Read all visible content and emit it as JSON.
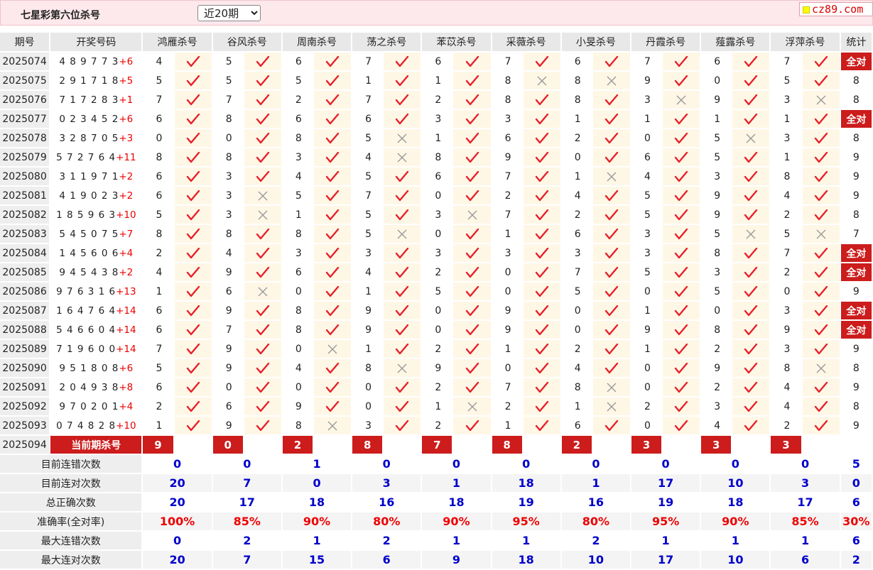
{
  "header": {
    "title": "七星彩第六位杀号",
    "period_select": "近20期",
    "logo_text": "cz89.com"
  },
  "columns": {
    "issue": "期号",
    "draw": "开奖号码",
    "experts": [
      "鸿雁杀号",
      "谷风杀号",
      "周南杀号",
      "荡之杀号",
      "苯苡杀号",
      "采薇杀号",
      "小旻杀号",
      "丹霞杀号",
      "薤露杀号",
      "浮萍杀号"
    ],
    "stat": "统计"
  },
  "rows": [
    {
      "issue": "2025074",
      "digits": "489773",
      "sum": "+6",
      "kills": [
        4,
        5,
        6,
        7,
        6,
        7,
        6,
        7,
        6,
        7
      ],
      "hits": [
        1,
        1,
        1,
        1,
        1,
        1,
        1,
        1,
        1,
        1
      ],
      "stat": "全对"
    },
    {
      "issue": "2025075",
      "digits": "291718",
      "sum": "+5",
      "kills": [
        5,
        5,
        5,
        1,
        1,
        8,
        8,
        9,
        0,
        5
      ],
      "hits": [
        1,
        1,
        1,
        1,
        1,
        0,
        0,
        1,
        1,
        1
      ],
      "stat": "8"
    },
    {
      "issue": "2025076",
      "digits": "717283",
      "sum": "+1",
      "kills": [
        7,
        7,
        2,
        7,
        2,
        8,
        8,
        3,
        9,
        3
      ],
      "hits": [
        1,
        1,
        1,
        1,
        1,
        1,
        1,
        0,
        1,
        0
      ],
      "stat": "8"
    },
    {
      "issue": "2025077",
      "digits": "023452",
      "sum": "+6",
      "kills": [
        6,
        8,
        6,
        6,
        3,
        3,
        1,
        1,
        1,
        1
      ],
      "hits": [
        1,
        1,
        1,
        1,
        1,
        1,
        1,
        1,
        1,
        1
      ],
      "stat": "全对"
    },
    {
      "issue": "2025078",
      "digits": "328705",
      "sum": "+3",
      "kills": [
        0,
        0,
        8,
        5,
        1,
        6,
        2,
        0,
        5,
        3
      ],
      "hits": [
        1,
        1,
        1,
        0,
        1,
        1,
        1,
        1,
        0,
        1
      ],
      "stat": "8"
    },
    {
      "issue": "2025079",
      "digits": "572764",
      "sum": "+11",
      "kills": [
        8,
        8,
        3,
        4,
        8,
        9,
        0,
        6,
        5,
        1
      ],
      "hits": [
        1,
        1,
        1,
        0,
        1,
        1,
        1,
        1,
        1,
        1
      ],
      "stat": "9"
    },
    {
      "issue": "2025080",
      "digits": "311971",
      "sum": "+2",
      "kills": [
        6,
        3,
        4,
        5,
        6,
        7,
        1,
        4,
        3,
        8
      ],
      "hits": [
        1,
        1,
        1,
        1,
        1,
        1,
        0,
        1,
        1,
        1
      ],
      "stat": "9"
    },
    {
      "issue": "2025081",
      "digits": "419023",
      "sum": "+2",
      "kills": [
        6,
        3,
        5,
        7,
        0,
        2,
        4,
        5,
        9,
        4
      ],
      "hits": [
        1,
        0,
        1,
        1,
        1,
        1,
        1,
        1,
        1,
        1
      ],
      "stat": "9"
    },
    {
      "issue": "2025082",
      "digits": "185963",
      "sum": "+10",
      "kills": [
        5,
        3,
        1,
        5,
        3,
        7,
        2,
        5,
        9,
        2
      ],
      "hits": [
        1,
        0,
        1,
        1,
        0,
        1,
        1,
        1,
        1,
        1
      ],
      "stat": "8"
    },
    {
      "issue": "2025083",
      "digits": "545075",
      "sum": "+7",
      "kills": [
        8,
        8,
        8,
        5,
        0,
        1,
        6,
        3,
        5,
        5
      ],
      "hits": [
        1,
        1,
        1,
        0,
        1,
        1,
        1,
        1,
        0,
        0
      ],
      "stat": "7"
    },
    {
      "issue": "2025084",
      "digits": "145606",
      "sum": "+4",
      "kills": [
        2,
        4,
        3,
        3,
        3,
        3,
        3,
        3,
        8,
        7
      ],
      "hits": [
        1,
        1,
        1,
        1,
        1,
        1,
        1,
        1,
        1,
        1
      ],
      "stat": "全对"
    },
    {
      "issue": "2025085",
      "digits": "945438",
      "sum": "+2",
      "kills": [
        4,
        9,
        6,
        4,
        2,
        0,
        7,
        5,
        3,
        2
      ],
      "hits": [
        1,
        1,
        1,
        1,
        1,
        1,
        1,
        1,
        1,
        1
      ],
      "stat": "全对"
    },
    {
      "issue": "2025086",
      "digits": "976316",
      "sum": "+13",
      "kills": [
        1,
        6,
        0,
        1,
        5,
        0,
        5,
        0,
        5,
        0
      ],
      "hits": [
        1,
        0,
        1,
        1,
        1,
        1,
        1,
        1,
        1,
        1
      ],
      "stat": "9"
    },
    {
      "issue": "2025087",
      "digits": "164764",
      "sum": "+14",
      "kills": [
        6,
        9,
        8,
        9,
        0,
        9,
        0,
        1,
        0,
        3
      ],
      "hits": [
        1,
        1,
        1,
        1,
        1,
        1,
        1,
        1,
        1,
        1
      ],
      "stat": "全对"
    },
    {
      "issue": "2025088",
      "digits": "546604",
      "sum": "+14",
      "kills": [
        6,
        7,
        8,
        9,
        0,
        9,
        0,
        9,
        8,
        9
      ],
      "hits": [
        1,
        1,
        1,
        1,
        1,
        1,
        1,
        1,
        1,
        1
      ],
      "stat": "全对"
    },
    {
      "issue": "2025089",
      "digits": "719600",
      "sum": "+14",
      "kills": [
        7,
        9,
        0,
        1,
        2,
        1,
        2,
        1,
        2,
        3
      ],
      "hits": [
        1,
        1,
        0,
        1,
        1,
        1,
        1,
        1,
        1,
        1
      ],
      "stat": "9"
    },
    {
      "issue": "2025090",
      "digits": "951808",
      "sum": "+6",
      "kills": [
        5,
        9,
        4,
        8,
        9,
        0,
        4,
        0,
        9,
        8
      ],
      "hits": [
        1,
        1,
        1,
        0,
        1,
        1,
        1,
        1,
        1,
        0
      ],
      "stat": "8"
    },
    {
      "issue": "2025091",
      "digits": "204938",
      "sum": "+8",
      "kills": [
        6,
        0,
        0,
        0,
        2,
        7,
        8,
        0,
        2,
        4
      ],
      "hits": [
        1,
        1,
        1,
        1,
        1,
        1,
        0,
        1,
        1,
        1
      ],
      "stat": "9"
    },
    {
      "issue": "2025092",
      "digits": "970201",
      "sum": "+4",
      "kills": [
        2,
        6,
        9,
        0,
        1,
        2,
        1,
        2,
        3,
        4
      ],
      "hits": [
        1,
        1,
        1,
        1,
        0,
        1,
        0,
        1,
        1,
        1
      ],
      "stat": "8"
    },
    {
      "issue": "2025093",
      "digits": "074828",
      "sum": "+10",
      "kills": [
        1,
        9,
        8,
        3,
        2,
        1,
        6,
        0,
        4,
        2
      ],
      "hits": [
        1,
        1,
        0,
        1,
        1,
        1,
        1,
        1,
        1,
        1
      ],
      "stat": "9"
    }
  ],
  "current": {
    "issue": "2025094",
    "label": "当前期杀号",
    "kills": [
      9,
      0,
      2,
      8,
      7,
      8,
      2,
      3,
      3,
      3
    ]
  },
  "summary": [
    {
      "label": "目前连错次数",
      "values": [
        "0",
        "0",
        "1",
        "0",
        "0",
        "0",
        "0",
        "0",
        "0",
        "0"
      ],
      "stat": "5"
    },
    {
      "label": "目前连对次数",
      "values": [
        "20",
        "7",
        "0",
        "3",
        "1",
        "18",
        "1",
        "17",
        "10",
        "3"
      ],
      "stat": "0"
    },
    {
      "label": "总正确次数",
      "values": [
        "20",
        "17",
        "18",
        "16",
        "18",
        "19",
        "16",
        "19",
        "18",
        "17"
      ],
      "stat": "6"
    },
    {
      "label": "准确率(全对率)",
      "values": [
        "100%",
        "85%",
        "90%",
        "80%",
        "90%",
        "95%",
        "80%",
        "95%",
        "90%",
        "85%"
      ],
      "stat": "30%"
    },
    {
      "label": "最大连错次数",
      "values": [
        "0",
        "2",
        "1",
        "2",
        "1",
        "1",
        "2",
        "1",
        "1",
        "1"
      ],
      "stat": "6"
    },
    {
      "label": "最大连对次数",
      "values": [
        "20",
        "7",
        "15",
        "6",
        "9",
        "18",
        "10",
        "17",
        "10",
        "6"
      ],
      "stat": "2"
    }
  ],
  "colors": {
    "accent_red": "#cc1c1c",
    "check": "#e8202a",
    "cross": "#999999",
    "summary_blue": "#0000cc",
    "header_bg": "#fde8ec"
  },
  "icons": {
    "hit": "check-icon",
    "miss": "cross-icon"
  }
}
